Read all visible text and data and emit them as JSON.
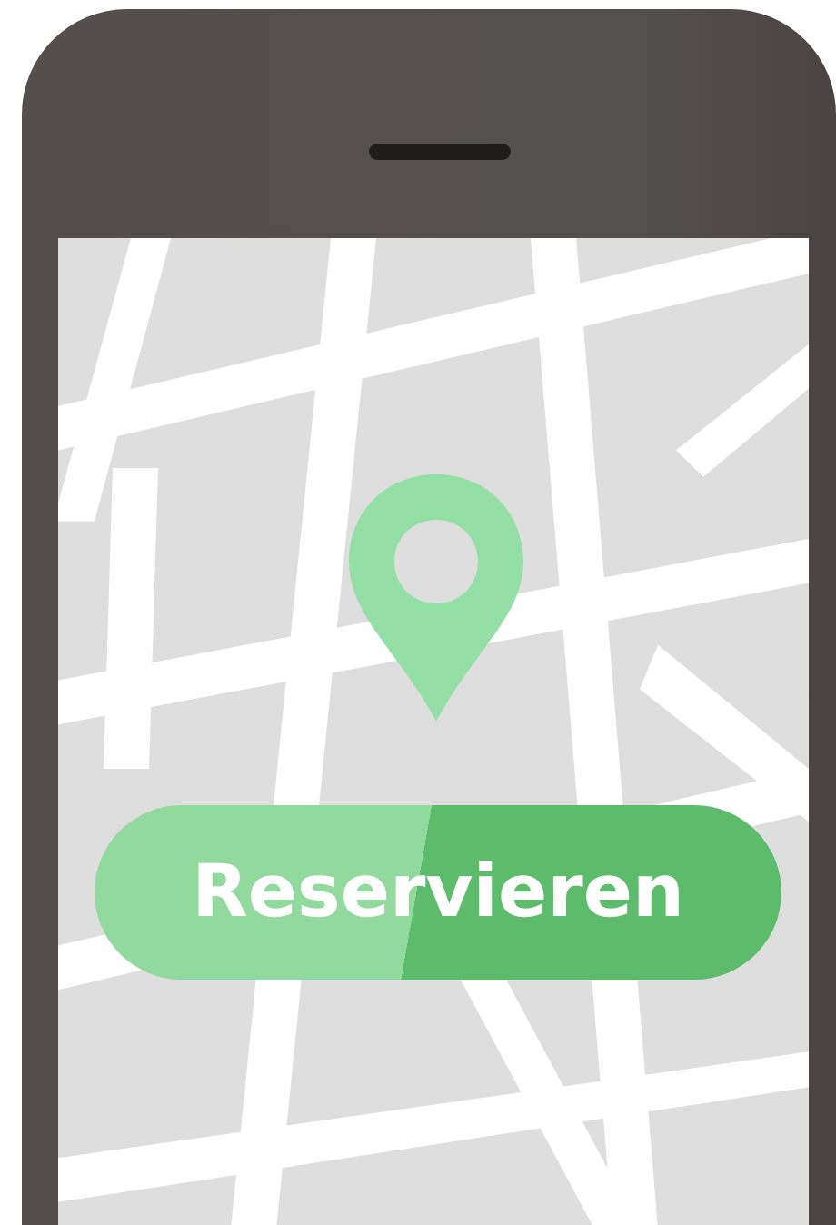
{
  "button": {
    "label": "Reservieren"
  }
}
